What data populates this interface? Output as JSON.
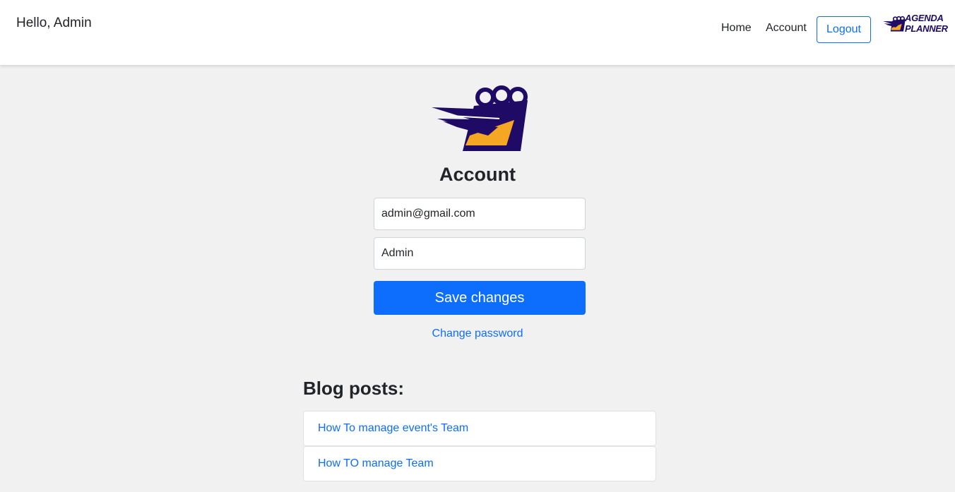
{
  "navbar": {
    "greeting": "Hello, Admin",
    "links": [
      {
        "label": "Home"
      },
      {
        "label": "Account"
      }
    ],
    "logout_label": "Logout",
    "brand": {
      "line1": "AGENDA",
      "line2": "PLANNER",
      "icon": "agenda-planner-logo"
    }
  },
  "main": {
    "logo_icon": "calendar-logo",
    "title": "Account",
    "email_value": "admin@gmail.com",
    "name_value": "Admin",
    "save_label": "Save changes",
    "change_password_label": "Change password"
  },
  "blog": {
    "heading": "Blog posts:",
    "posts": [
      {
        "title": "How To manage event's Team"
      },
      {
        "title": "How TO manage Team"
      }
    ]
  },
  "colors": {
    "primary": "#0d6efd",
    "brand_navy": "#1f0b66",
    "brand_orange": "#f5a623",
    "background": "#f1f1f1"
  }
}
